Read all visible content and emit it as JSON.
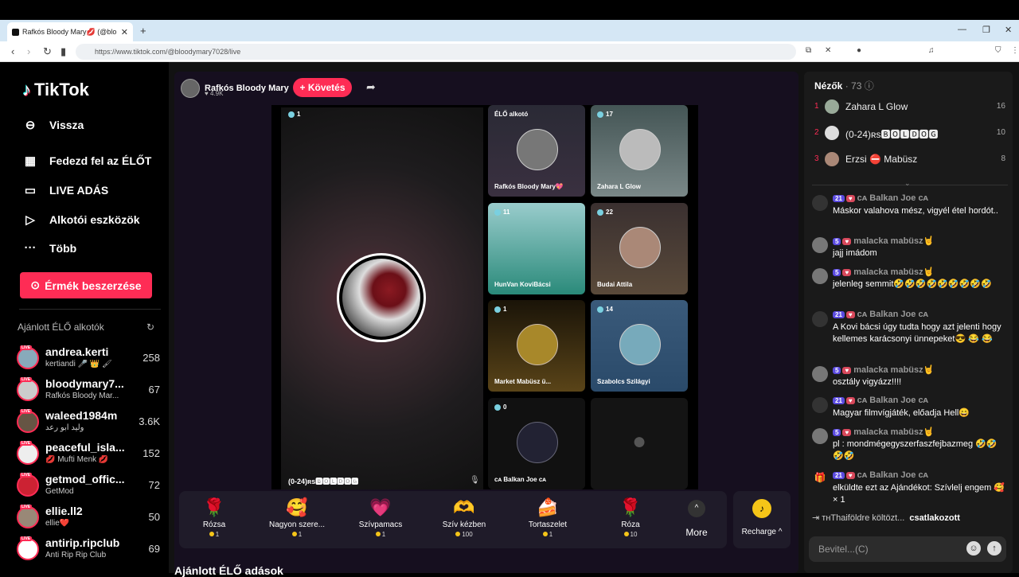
{
  "browser": {
    "tab_title": "Rafkós Bloody Mary💋 (@blo",
    "url": "https://www.tiktok.com/@bloodymary7028/live"
  },
  "sidebar": {
    "logo": "TikTok",
    "back": "Vissza",
    "items": [
      {
        "label": "Fedezd fel az ÉLŐT",
        "icon": "calendar-icon"
      },
      {
        "label": "LIVE ADÁS",
        "icon": "video-camera-icon"
      },
      {
        "label": "Alkotói eszközök",
        "icon": "creator-tools-icon"
      },
      {
        "label": "Több",
        "icon": "more-dots-icon"
      }
    ],
    "coins_button": "Érmék beszerzése",
    "recommended_title": "Ajánlott ÉLŐ alkotók",
    "creators": [
      {
        "name": "andrea.kerti",
        "sub": "kertiandi 🎤 👑 🖌",
        "count": "258"
      },
      {
        "name": "bloodymary7...",
        "sub": "Rafkós Bloody Mar...",
        "count": "67"
      },
      {
        "name": "waleed1984m",
        "sub": "وليد ابو رعد",
        "count": "3.6K"
      },
      {
        "name": "peaceful_isla...",
        "sub": "💋 Mufti Menk 💋",
        "count": "152"
      },
      {
        "name": "getmod_offic...",
        "sub": "GetMod",
        "count": "72"
      },
      {
        "name": "ellie.ll2",
        "sub": "ellie❤️",
        "count": "50"
      },
      {
        "name": "antirip.ripclub",
        "sub": "Anti Rip Rip Club",
        "count": "69"
      }
    ]
  },
  "host": {
    "name": "Rafkós Bloody Mary",
    "likes": "4.9K",
    "follow": "+ Követés"
  },
  "main_video": {
    "viewers": "1",
    "label": "(0-24)ʀs🅱🅾🅻🅳🅾🅶"
  },
  "guests": [
    {
      "name": "Rafkós Bloody Mary💖",
      "viewers": "ÉLŐ alkotó"
    },
    {
      "name": "Zahara L Glow",
      "viewers": "17"
    },
    {
      "name": "HunVan KoviBácsi",
      "viewers": "11"
    },
    {
      "name": "Budai Attila",
      "viewers": "22"
    },
    {
      "name": "Market Mabüsz ü...",
      "viewers": "1"
    },
    {
      "name": "Szabolcs Szilágyi",
      "viewers": "14"
    },
    {
      "name": "ᴄᴀ Balkan Joe ᴄᴀ",
      "viewers": "0"
    },
    {
      "name": "",
      "viewers": ""
    }
  ],
  "gifts": [
    {
      "name": "Rózsa",
      "price": "1",
      "icon": "🌹"
    },
    {
      "name": "Nagyon szere...",
      "price": "1",
      "icon": "🥰"
    },
    {
      "name": "Szívpamacs",
      "price": "1",
      "icon": "💗"
    },
    {
      "name": "Szív kézben",
      "price": "100",
      "icon": "🫶"
    },
    {
      "name": "Tortaszelet",
      "price": "1",
      "icon": "🍰"
    },
    {
      "name": "Róza",
      "price": "10",
      "icon": "🌹"
    }
  ],
  "more": "More",
  "recharge": "Recharge ^",
  "bottom_title": "Ajánlott ÉLŐ adások",
  "viewers_panel": {
    "title": "Nézők",
    "count": "· 73",
    "top": [
      {
        "rank": "1",
        "name": "Zahara L Glow",
        "score": "16"
      },
      {
        "rank": "2",
        "name": "(0-24)ʀs🅱🅾🅻🅳🅾🅶",
        "score": "10"
      },
      {
        "rank": "3",
        "name": "Erzsi ⛔ Mabüsz",
        "score": "8"
      }
    ]
  },
  "chat": [
    {
      "lvl": "21",
      "user": "ᴄᴀ Balkan Joe ᴄᴀ",
      "text": "Máskor valahova mész, vigyél étel hordót.."
    },
    {
      "lvl": "5",
      "user": "malacka mabüsz🤘",
      "text": "jajj imádom"
    },
    {
      "lvl": "5",
      "user": "malacka mabüsz🤘",
      "text": "jelenleg semmit🤣🤣🤣🤣🤣🤣🤣🤣🤣"
    },
    {
      "lvl": "21",
      "user": "ᴄᴀ Balkan Joe ᴄᴀ",
      "text": "A Kovi bácsi úgy tudta hogy azt jelenti hogy kellemes karácsonyi ünnepeket😎 😂 😂"
    },
    {
      "lvl": "5",
      "user": "malacka mabüsz🤘",
      "text": "osztály vigyázz!!!!"
    },
    {
      "lvl": "21",
      "user": "ᴄᴀ Balkan Joe ᴄᴀ",
      "text": "Magyar filmvígjáték, előadja Hell😄"
    },
    {
      "lvl": "5",
      "user": "malacka mabüsz🤘",
      "text": "pl : mondmégegyszerfaszfejbazmeg 🤣🤣🤣🤣"
    },
    {
      "lvl": "21",
      "user": "ᴄᴀ Balkan Joe ᴄᴀ",
      "text": "elküldte ezt az Ajándékot: Szívlelj engem 🥰 × 1"
    }
  ],
  "joined": {
    "user": "ᴛʜThaiföldre költözt...",
    "action": "csatlakozott"
  },
  "input_placeholder": "Bevitel...(C)"
}
